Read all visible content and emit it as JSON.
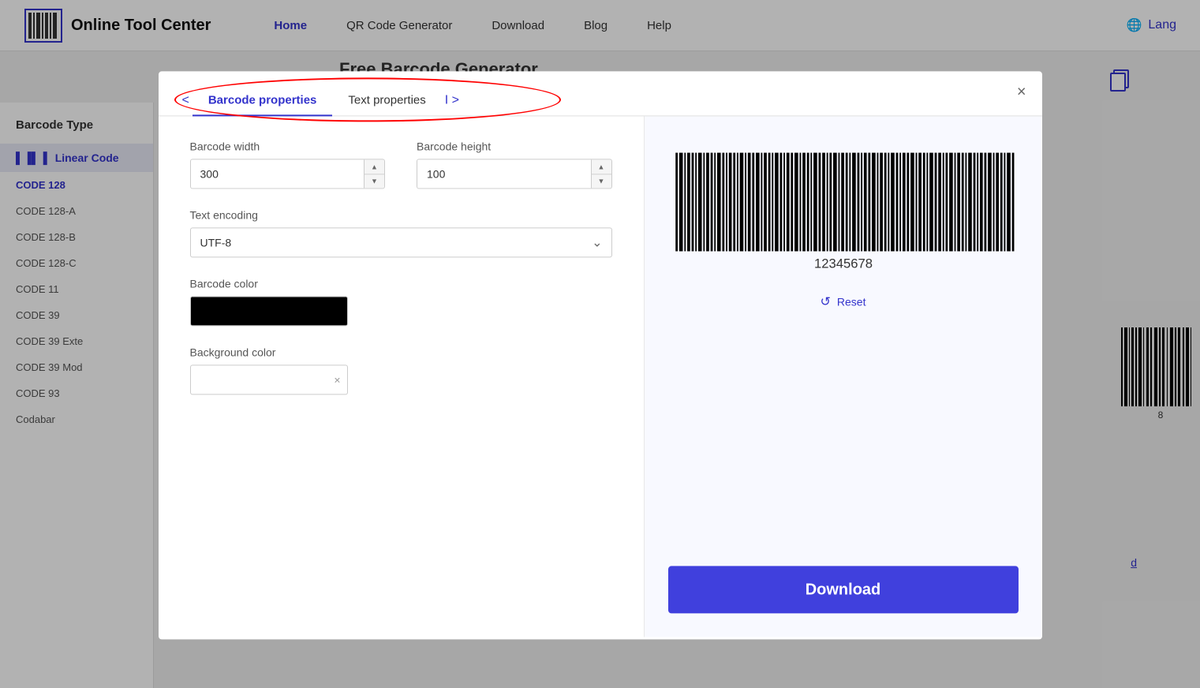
{
  "header": {
    "logo_text": "Online Tool Center",
    "nav": [
      {
        "label": "Home",
        "active": true
      },
      {
        "label": "QR Code Generator",
        "active": false
      },
      {
        "label": "Download",
        "active": false
      },
      {
        "label": "Blog",
        "active": false
      },
      {
        "label": "Help",
        "active": false
      }
    ],
    "lang_label": "Lang"
  },
  "sidebar": {
    "title": "Barcode Type",
    "main_item": "Linear Code",
    "sub_items": [
      {
        "label": "CODE 128",
        "active": true,
        "selected": true
      },
      {
        "label": "CODE 128-A",
        "active": false
      },
      {
        "label": "CODE 128-B",
        "active": false
      },
      {
        "label": "CODE 128-C",
        "active": false
      },
      {
        "label": "CODE 11",
        "active": false
      },
      {
        "label": "CODE 39",
        "active": false
      },
      {
        "label": "CODE 39 Exte",
        "active": false
      },
      {
        "label": "CODE 39 Mod",
        "active": false
      },
      {
        "label": "CODE 93",
        "active": false
      },
      {
        "label": "Codabar",
        "active": false
      }
    ]
  },
  "page_title": "Free Barcode Generator",
  "modal": {
    "tabs": [
      {
        "label": "Barcode properties",
        "active": true
      },
      {
        "label": "Text properties",
        "active": false
      }
    ],
    "tab_prev": "<",
    "tab_next": "I >",
    "close_label": "×",
    "fields": {
      "barcode_width_label": "Barcode width",
      "barcode_width_value": "300",
      "barcode_height_label": "Barcode height",
      "barcode_height_value": "100",
      "text_encoding_label": "Text encoding",
      "text_encoding_value": "UTF-8",
      "barcode_color_label": "Barcode color",
      "background_color_label": "Background color"
    },
    "barcode_text": "12345678",
    "reset_label": "Reset",
    "download_label": "Download"
  }
}
